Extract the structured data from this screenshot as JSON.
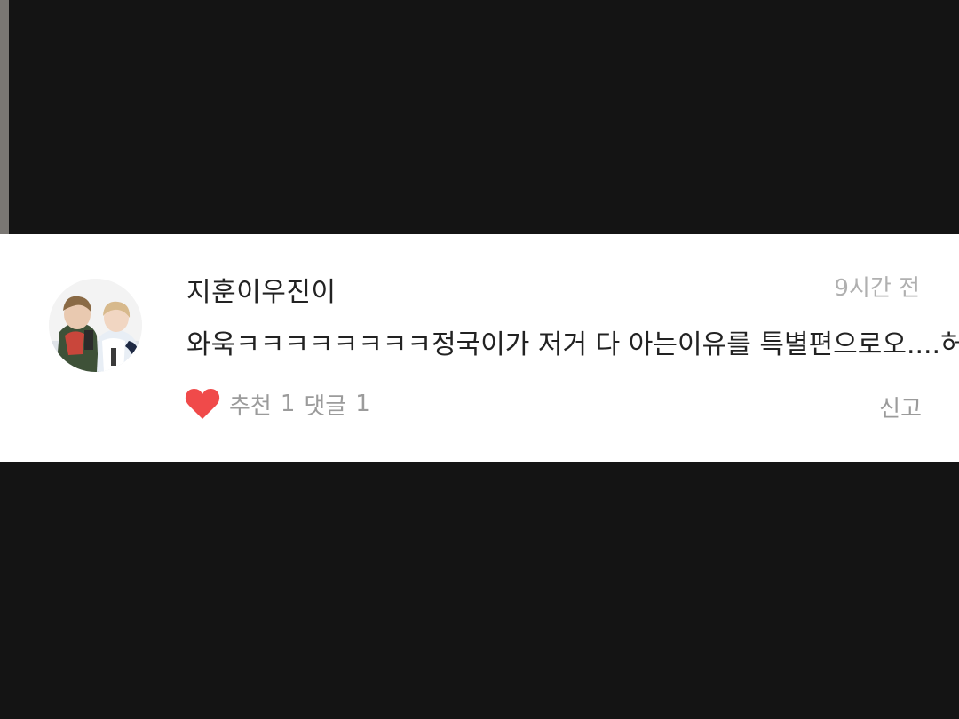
{
  "comment": {
    "username": "지훈이우진이",
    "timestamp": "9시간 전",
    "text": "와욱ㅋㅋㅋㅋㅋㅋㅋㅋ정국이가 저거 다 아는이유를 특별편으로오....허헣",
    "recommend_label": "추천",
    "recommend_count": "1",
    "reply_label": "댓글",
    "reply_count": "1",
    "report_label": "신고"
  },
  "icons": {
    "like": "heart-icon",
    "avatar": "avatar"
  },
  "colors": {
    "background": "#141414",
    "card": "#ffffff",
    "heart": "#f04a4a",
    "text": "#222222",
    "muted": "#9b9b9b",
    "timestamp": "#b0b0b0"
  }
}
